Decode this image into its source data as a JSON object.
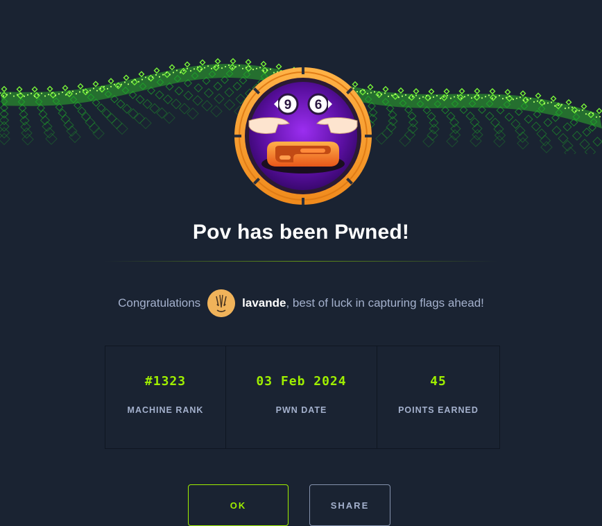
{
  "title": "Pov has been Pwned!",
  "congrats": {
    "prefix": "Congratulations",
    "username": "lavande",
    "suffix": ", best of luck in capturing flags ahead!"
  },
  "stats": [
    {
      "value": "#1323",
      "label": "MACHINE RANK"
    },
    {
      "value": "03 Feb 2024",
      "label": "PWN DATE"
    },
    {
      "value": "45",
      "label": "POINTS EARNED"
    }
  ],
  "buttons": {
    "ok": "OK",
    "share": "SHARE"
  },
  "badge": {
    "left_digit": "9",
    "right_digit": "6"
  },
  "colors": {
    "background": "#1a2332",
    "accent_green": "#9fef00",
    "muted_text": "#a4b1cd",
    "badge_orange": "#f5a623",
    "badge_purple": "#6a1fb0"
  }
}
